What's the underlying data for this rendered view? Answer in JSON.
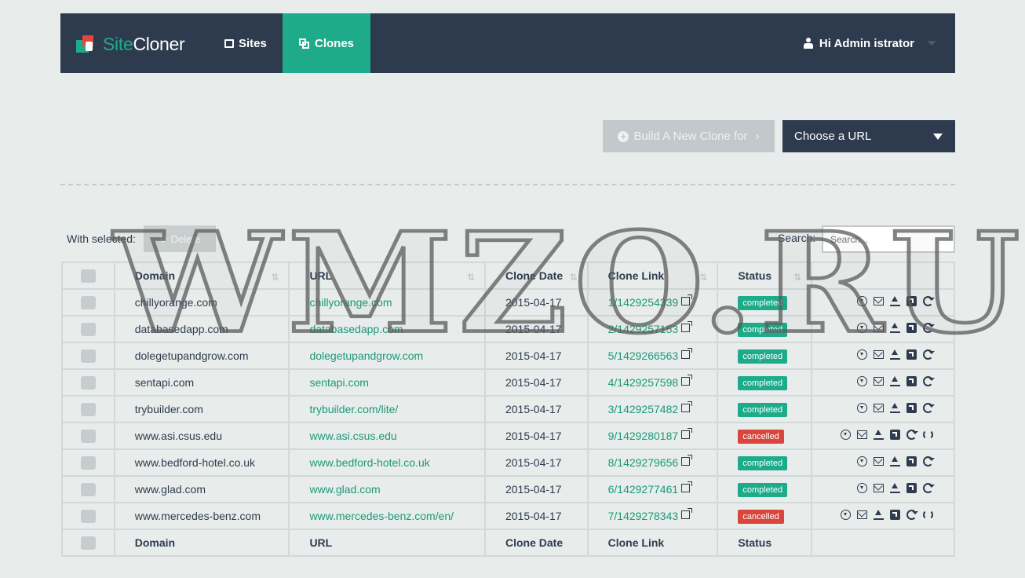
{
  "brand": {
    "part1": "Site",
    "part2": "Cloner"
  },
  "nav": {
    "items": [
      {
        "label": "Sites",
        "active": false
      },
      {
        "label": "Clones",
        "active": true
      }
    ],
    "user_label": "Hi Admin istrator"
  },
  "toolbar": {
    "build_label": "Build A New Clone for",
    "url_select_value": "Choose a URL"
  },
  "bulk": {
    "with_selected_label": "With selected:",
    "delete_label": "Delete"
  },
  "search": {
    "label": "Search:",
    "placeholder": "Search..."
  },
  "table": {
    "headers": [
      "Domain",
      "URL",
      "Clone Date",
      "Clone Link",
      "Status"
    ],
    "rows": [
      {
        "domain": "chillyorange.com",
        "url": "chillyorange.com",
        "date": "2015-04-17",
        "link": "1/1429254339",
        "status": "completed"
      },
      {
        "domain": "databasedapp.com",
        "url": "databasedapp.com",
        "date": "2015-04-17",
        "link": "2/1429257153",
        "status": "completed"
      },
      {
        "domain": "dolegetupandgrow.com",
        "url": "dolegetupandgrow.com",
        "date": "2015-04-17",
        "link": "5/1429266563",
        "status": "completed"
      },
      {
        "domain": "sentapi.com",
        "url": "sentapi.com",
        "date": "2015-04-17",
        "link": "4/1429257598",
        "status": "completed"
      },
      {
        "domain": "trybuilder.com",
        "url": "trybuilder.com/lite/",
        "date": "2015-04-17",
        "link": "3/1429257482",
        "status": "completed"
      },
      {
        "domain": "www.asi.csus.edu",
        "url": "www.asi.csus.edu",
        "date": "2015-04-17",
        "link": "9/1429280187",
        "status": "cancelled"
      },
      {
        "domain": "www.bedford-hotel.co.uk",
        "url": "www.bedford-hotel.co.uk",
        "date": "2015-04-17",
        "link": "8/1429279656",
        "status": "completed"
      },
      {
        "domain": "www.glad.com",
        "url": "www.glad.com",
        "date": "2015-04-17",
        "link": "6/1429277461",
        "status": "completed"
      },
      {
        "domain": "www.mercedes-benz.com",
        "url": "www.mercedes-benz.com/en/",
        "date": "2015-04-17",
        "link": "7/1429278343",
        "status": "cancelled"
      }
    ]
  },
  "watermark": "WMZO.RU",
  "colors": {
    "navbar": "#2e3b4e",
    "accent": "#1dab8a",
    "danger": "#d9463c",
    "background": "#e8eceb"
  }
}
